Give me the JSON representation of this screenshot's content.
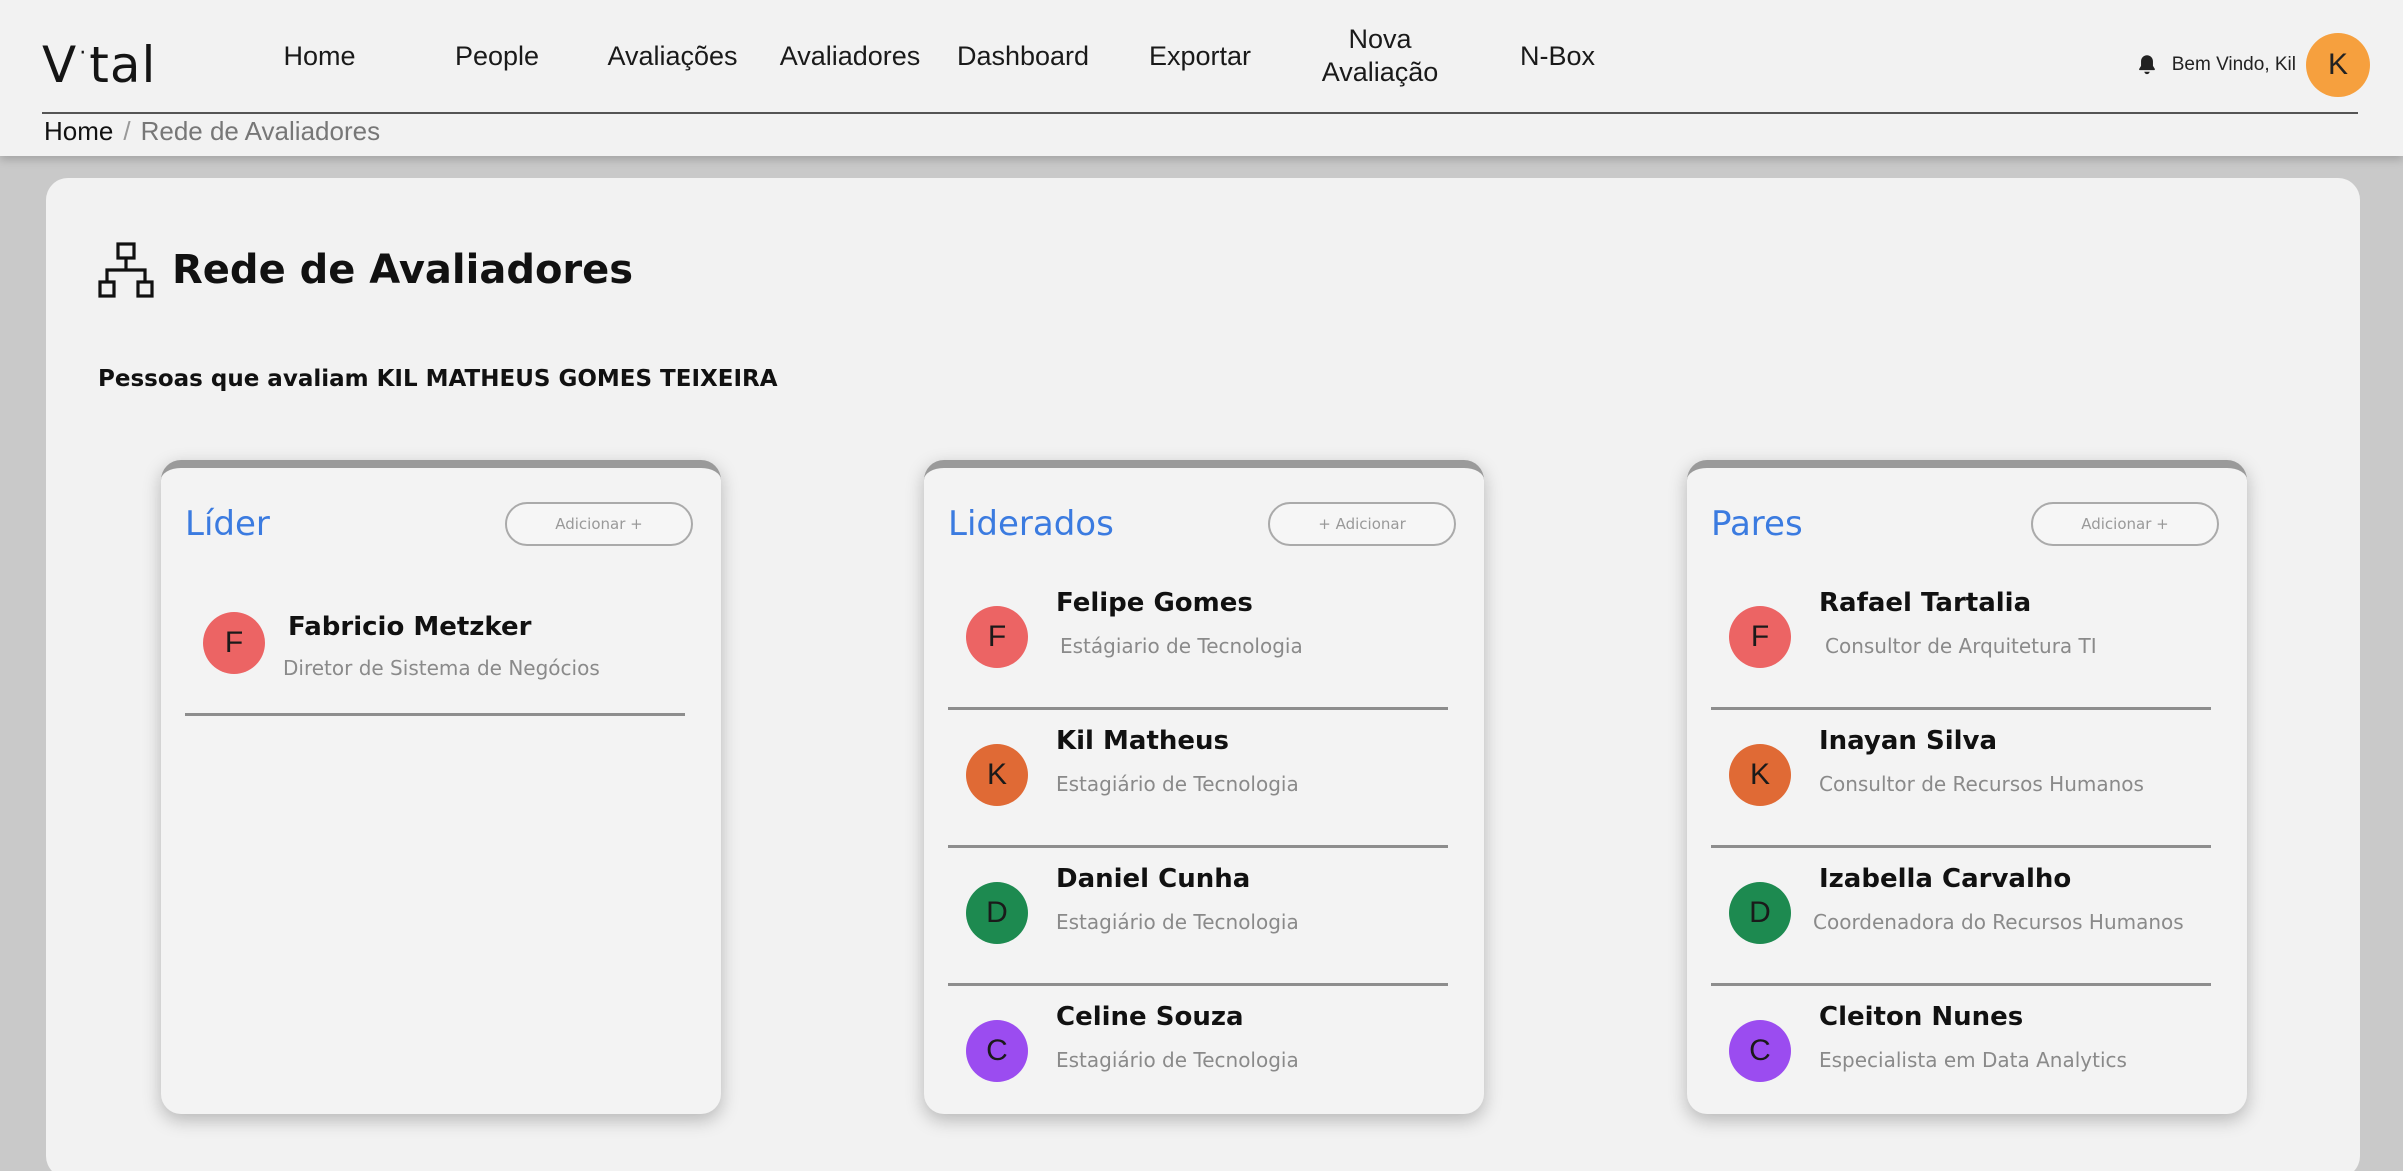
{
  "brand": {
    "logo_left": "V",
    "logo_right": "tal"
  },
  "nav": [
    {
      "label": "Home"
    },
    {
      "label": "People"
    },
    {
      "label": "Avaliações"
    },
    {
      "label": "Avaliadores"
    },
    {
      "label": "Dashboard"
    },
    {
      "label": "Exportar"
    },
    {
      "label": "Nova\nAvaliação"
    },
    {
      "label": "N-Box"
    }
  ],
  "user": {
    "welcome": "Bem Vindo, Kil",
    "initial": "K",
    "avatar_color": "#f6a03e"
  },
  "breadcrumb": {
    "home": "Home",
    "separator": "/",
    "current": "Rede de Avaliadores"
  },
  "page": {
    "title": "Rede de Avaliadores",
    "subtitle": "Pessoas que avaliam KIL MATHEUS GOMES TEIXEIRA"
  },
  "colors": {
    "accent": "#3b7be0",
    "avatar_red": "#ec6464",
    "avatar_orange": "#e06a35",
    "avatar_green": "#1d8a50",
    "avatar_purple": "#9b4cf0"
  },
  "cards": [
    {
      "title": "Líder",
      "add_label": "Adicionar +",
      "people": [
        {
          "initial": "F",
          "name": "Fabricio Metzker",
          "role": "Diretor de Sistema de Negócios",
          "color": "#ec6464"
        }
      ]
    },
    {
      "title": "Liderados",
      "add_label": "+ Adicionar",
      "people": [
        {
          "initial": "F",
          "name": "Felipe Gomes",
          "role": "Estágiario de Tecnologia",
          "color": "#ec6464"
        },
        {
          "initial": "K",
          "name": "Kil Matheus",
          "role": "Estagiário de Tecnologia",
          "color": "#e06a35"
        },
        {
          "initial": "D",
          "name": "Daniel Cunha",
          "role": "Estagiário de Tecnologia",
          "color": "#1d8a50"
        },
        {
          "initial": "C",
          "name": "Celine Souza",
          "role": "Estagiário de Tecnologia",
          "color": "#9b4cf0"
        }
      ]
    },
    {
      "title": "Pares",
      "add_label": "Adicionar +",
      "people": [
        {
          "initial": "F",
          "name": "Rafael Tartalia",
          "role": "Consultor de Arquitetura TI",
          "color": "#ec6464"
        },
        {
          "initial": "K",
          "name": "Inayan Silva",
          "role": "Consultor de Recursos Humanos",
          "color": "#e06a35"
        },
        {
          "initial": "D",
          "name": "Izabella Carvalho",
          "role": "Coordenadora do Recursos Humanos",
          "color": "#1d8a50"
        },
        {
          "initial": "C",
          "name": "Cleiton Nunes",
          "role": "Especialista em Data Analytics",
          "color": "#9b4cf0"
        }
      ]
    }
  ]
}
